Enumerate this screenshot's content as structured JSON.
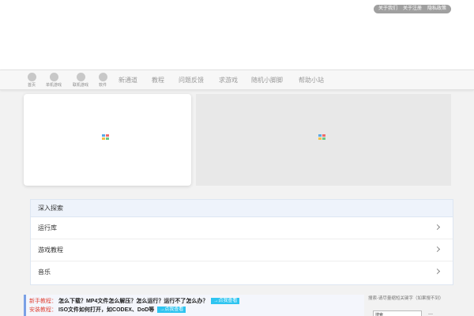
{
  "header": {
    "top_links": [
      "关于我们",
      "关于注册",
      "隐私政策"
    ]
  },
  "nav": {
    "icon_items": [
      {
        "label": "首页",
        "icon": "home-icon"
      },
      {
        "label": "单机游戏",
        "icon": "game-icon"
      },
      {
        "label": "联机游戏",
        "icon": "online-game-icon"
      },
      {
        "label": "软件",
        "icon": "software-icon"
      }
    ],
    "text_items": [
      "新通道",
      "教程",
      "问题反馈",
      "求游戏",
      "随机小脚脚",
      "帮助小站"
    ]
  },
  "explore": {
    "title": "深入探索",
    "rows": [
      "运行库",
      "游戏教程",
      "音乐"
    ]
  },
  "notice": {
    "lines": [
      {
        "tag": "新手教程：",
        "text": "怎么下载？MP4文件怎么解压？怎么运行？运行不了怎么办？",
        "button": "→点我查看"
      },
      {
        "tag": "安装教程：",
        "text": "ISO文件如何打开，如CODEX、DoD等",
        "button": "→点我查看"
      }
    ]
  },
  "search": {
    "hint": "搜索-请尽量缩短关键字（如果搜不到）",
    "value": "搜索",
    "dash": "—"
  },
  "colors": {
    "accent_blue": "#2ec4f0",
    "tag_red": "#e0483b",
    "notice_border": "#7aa0e6"
  }
}
